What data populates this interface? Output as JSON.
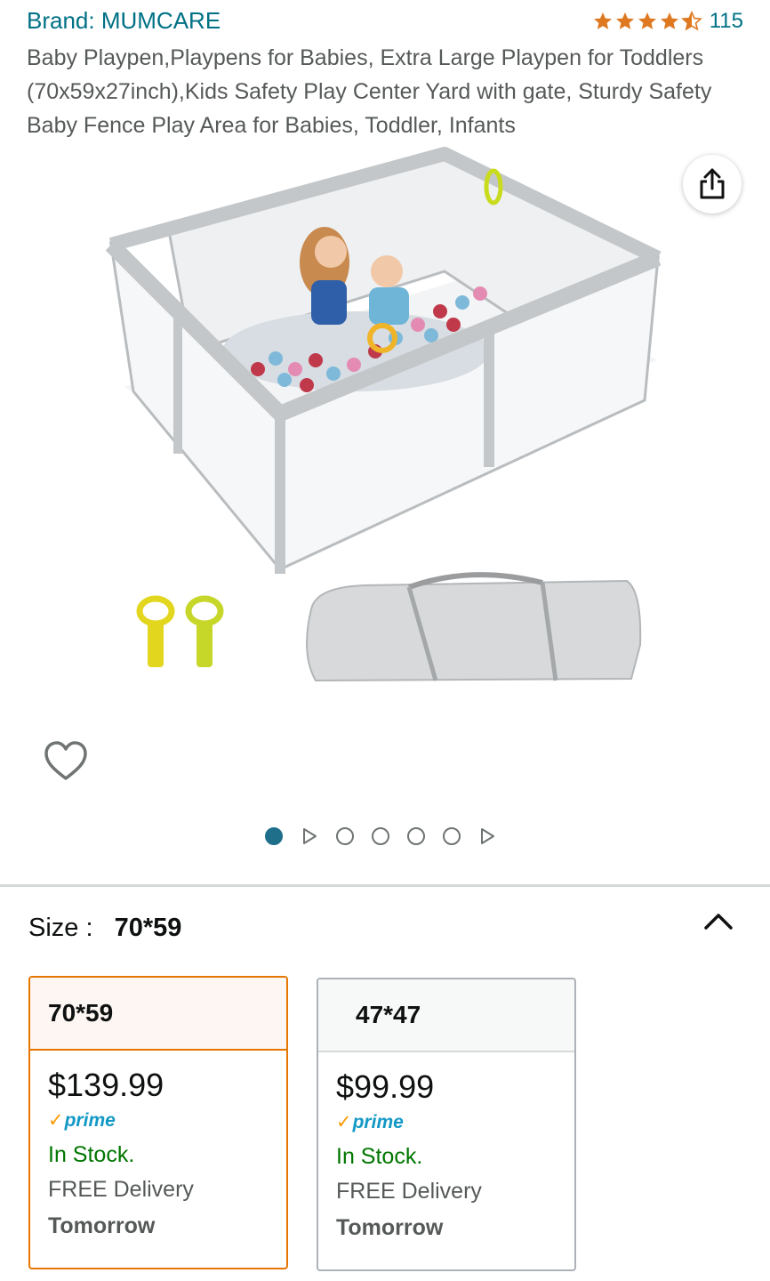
{
  "brand": "Brand: MUMCARE",
  "rating": {
    "value": 4.5,
    "count": "115"
  },
  "title": "Baby Playpen,Playpens for Babies, Extra Large Playpen for Toddlers (70x59x27inch),Kids Safety Play Center Yard with gate, Sturdy Safety Baby Fence Play Area for Babies, Toddler, Infants",
  "icons": {
    "share": "share-icon",
    "wishlist": "heart-icon",
    "collapse": "chevron-up-icon"
  },
  "carousel": {
    "total": 7,
    "active": 1
  },
  "size": {
    "label": "Size :",
    "value": "70*59"
  },
  "options": [
    {
      "name": "70*59",
      "price": "$139.99",
      "prime": "prime",
      "stock": "In Stock.",
      "delivery": "FREE Delivery",
      "date": "Tomorrow",
      "selected": true
    },
    {
      "name": "47*47",
      "price": "$99.99",
      "prime": "prime",
      "stock": "In Stock.",
      "delivery": "FREE Delivery",
      "date": "Tomorrow",
      "selected": false
    }
  ],
  "colors": {
    "link": "#007185",
    "star": "#de7921",
    "selected_border": "#e77600",
    "in_stock": "#007600",
    "prime": "#1399c5"
  }
}
